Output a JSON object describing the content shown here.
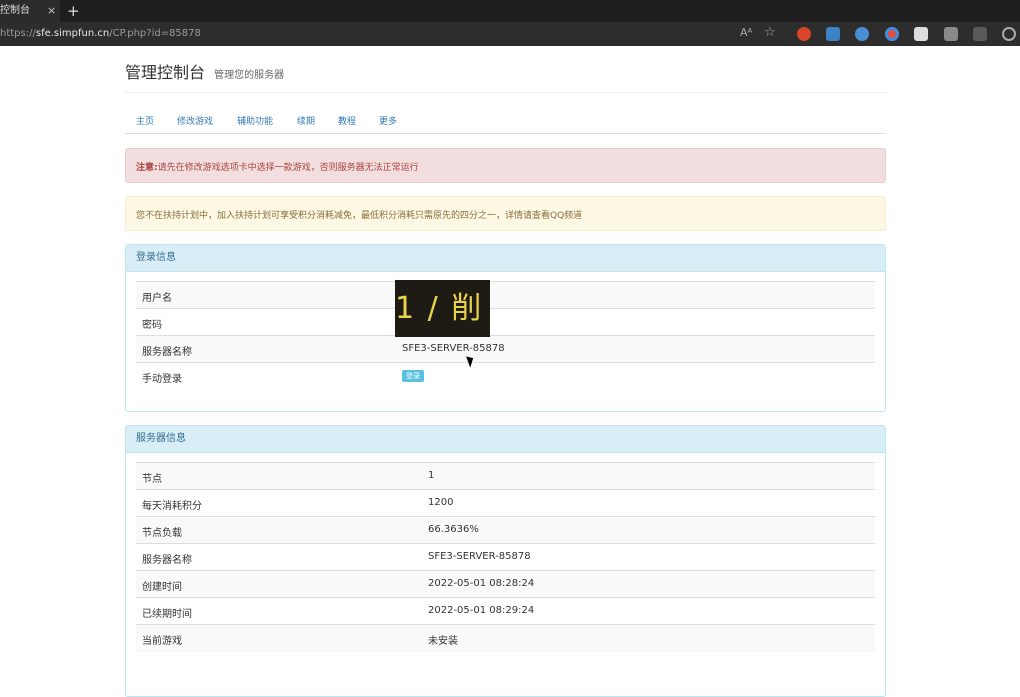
{
  "browser": {
    "tab_title": "控制台",
    "tab_close": "×",
    "new_tab": "+",
    "url_scheme": "https://",
    "url_host": "sfe.simpfun.cn",
    "url_path": "/CP.php?id=85878",
    "read_aloud": "Aᴬ",
    "favorite_glyph": "☆"
  },
  "header": {
    "title": "管理控制台",
    "subtitle": "管理您的服务器"
  },
  "nav": {
    "items": [
      "主页",
      "修改游戏",
      "辅助功能",
      "续期",
      "教程",
      "更多"
    ]
  },
  "alerts": {
    "danger_prefix": "注意:",
    "danger": "请先在修改游戏选项卡中选择一款游戏，否则服务器无法正常运行",
    "warning": "您不在扶持计划中，加入扶持计划可享受积分消耗减免，最低积分消耗只需原先的四分之一，详情请查看QQ频道"
  },
  "login_panel": {
    "heading": "登录信息",
    "rows": [
      {
        "label": "用户名",
        "value": ""
      },
      {
        "label": "密码",
        "value": ""
      },
      {
        "label": "服务器名称",
        "value": "SFE3-SERVER-85878"
      },
      {
        "label": "手动登录",
        "value": ""
      }
    ],
    "login_button": "登录",
    "overlay_text": "1 / 削"
  },
  "server_panel": {
    "heading": "服务器信息",
    "rows": [
      {
        "label": "节点",
        "value": "1"
      },
      {
        "label": "每天消耗积分",
        "value": "1200"
      },
      {
        "label": "节点负载",
        "value": "66.3636%"
      },
      {
        "label": "服务器名称",
        "value": "SFE3-SERVER-85878"
      },
      {
        "label": "创建时间",
        "value": "2022-05-01 08:28:24"
      },
      {
        "label": "已续期时间",
        "value": "2022-05-01 08:29:24"
      },
      {
        "label": "当前游戏",
        "value": "未安装"
      }
    ]
  },
  "colors": {
    "chrome_bg": "#1f1f1f",
    "link": "#337ab7",
    "panel_heading": "#d9edf7",
    "danger_bg": "#f2dede",
    "warning_bg": "#fcf8e3",
    "button_info": "#5bc0de"
  }
}
